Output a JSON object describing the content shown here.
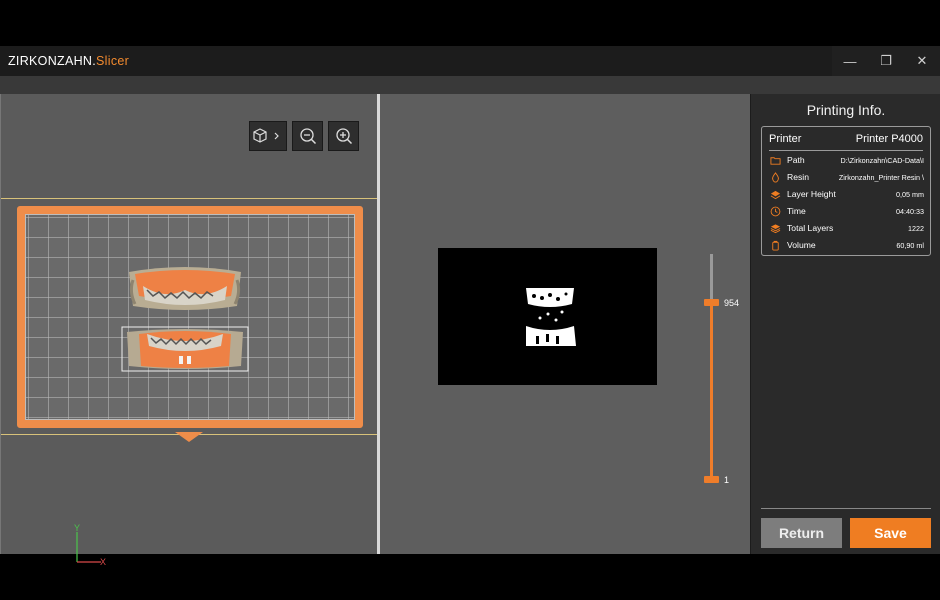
{
  "titlebar": {
    "brand": "ZIRKONZAHN.",
    "product": "Slicer",
    "controls": [
      {
        "name": "minimize",
        "glyph": "—"
      },
      {
        "name": "restore",
        "glyph": "❐"
      },
      {
        "name": "close",
        "glyph": "✕"
      }
    ]
  },
  "viewport": {
    "tools": [
      {
        "name": "view-cube",
        "icon": "cube-icon"
      },
      {
        "name": "zoom-out",
        "icon": "zoom-out-icon"
      },
      {
        "name": "zoom-in",
        "icon": "zoom-in-icon"
      }
    ],
    "axis": {
      "x": "X",
      "y": "Y"
    }
  },
  "slice_view": {
    "layer_max": "954",
    "layer_min": "1",
    "current_layer": 954,
    "total_layers": 1222
  },
  "panel": {
    "title": "Printing Info.",
    "printer_label": "Printer",
    "printer_value": "Printer P4000",
    "rows": [
      {
        "icon": "folder-icon",
        "label": "Path",
        "value": "D:\\Zirkonzahn\\CAD-Data\\I"
      },
      {
        "icon": "droplet-icon",
        "label": "Resin",
        "value": "Zirkonzahn_Printer Resin \\"
      },
      {
        "icon": "layer-height-icon",
        "label": "Layer Height",
        "value": "0,05 mm"
      },
      {
        "icon": "clock-icon",
        "label": "Time",
        "value": "04:40:33"
      },
      {
        "icon": "layers-icon",
        "label": "Total Layers",
        "value": "1222"
      },
      {
        "icon": "volume-icon",
        "label": "Volume",
        "value": "60,90 ml"
      }
    ],
    "return_label": "Return",
    "save_label": "Save"
  },
  "colors": {
    "accent": "#ef7d22",
    "platform": "#ef8d4a",
    "panel_bg": "#2a2a2a",
    "viewport_bg": "#5d5d5d"
  }
}
